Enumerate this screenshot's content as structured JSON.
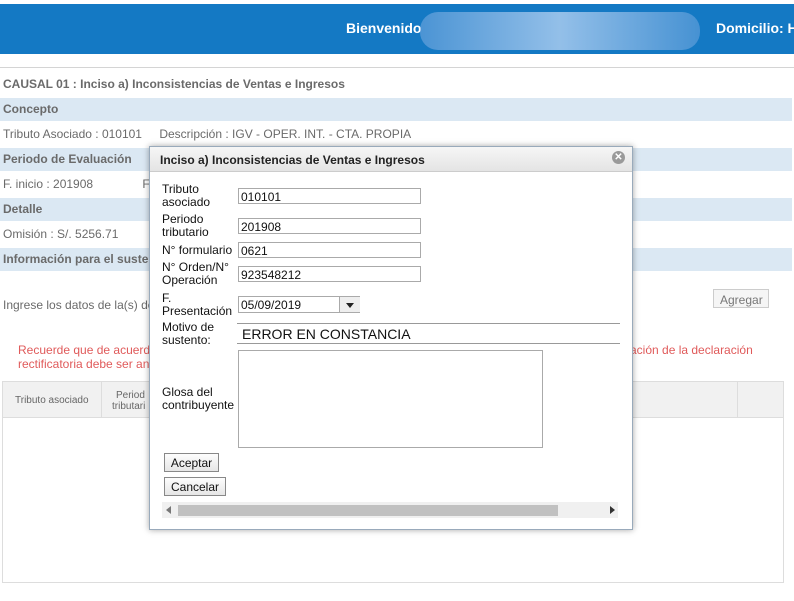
{
  "header": {
    "welcome": "Bienvenido",
    "domicilio": "Domicilio: Ha"
  },
  "page": {
    "causal_title": "CAUSAL 01 : Inciso a) Inconsistencias de Ventas e Ingresos",
    "concepto_header": "Concepto",
    "tributo_asociado": "Tributo Asociado : 010101",
    "descripcion": "Descripción : IGV - OPER. INT. - CTA. PROPIA",
    "periodo_header": "Periodo de Evaluación",
    "f_inicio": "F. inicio : 201908",
    "f_fin_partial": "F",
    "detalle_header": "Detalle",
    "omision": "Omisión : S/. 5256.71",
    "info_header": "Información para el suste",
    "ingrese": "Ingrese los datos de la(s) de",
    "agregar_button": "Agregar",
    "warning_line1": "Recuerde que de acuerd",
    "warning_line2": "rectificatoria debe ser an",
    "warning_right": "ación de la declaración",
    "grid_col1": "Tributo asociado",
    "grid_col2_line1": "Period",
    "grid_col2_line2": "tributari"
  },
  "dialog": {
    "title": "Inciso a) Inconsistencias de Ventas e Ingresos",
    "close_icon": "close-icon",
    "tributo_label_1": "Tributo",
    "tributo_label_2": "asociado",
    "tributo_value": "010101",
    "periodo_label_1": "Periodo",
    "periodo_label_2": "tributario",
    "periodo_value": "201908",
    "formulario_label": "N° formulario",
    "formulario_value": "0621",
    "orden_label_1": "N° Orden/N°",
    "orden_label_2": "Operación",
    "orden_value": "923548212",
    "presentacion_label_1": "F.",
    "presentacion_label_2": "Presentación",
    "presentacion_value": "05/09/2019",
    "motivo_label_1": "Motivo de",
    "motivo_label_2": "sustento:",
    "motivo_value": "ERROR EN CONSTANCIA",
    "glosa_label_1": "Glosa del",
    "glosa_label_2": "contribuyente",
    "aceptar_button": "Aceptar",
    "cancelar_button": "Cancelar"
  },
  "colors": {
    "header_bg": "#1479c4",
    "section_bg": "#dbe8f3",
    "warning": "#e05a5a"
  }
}
